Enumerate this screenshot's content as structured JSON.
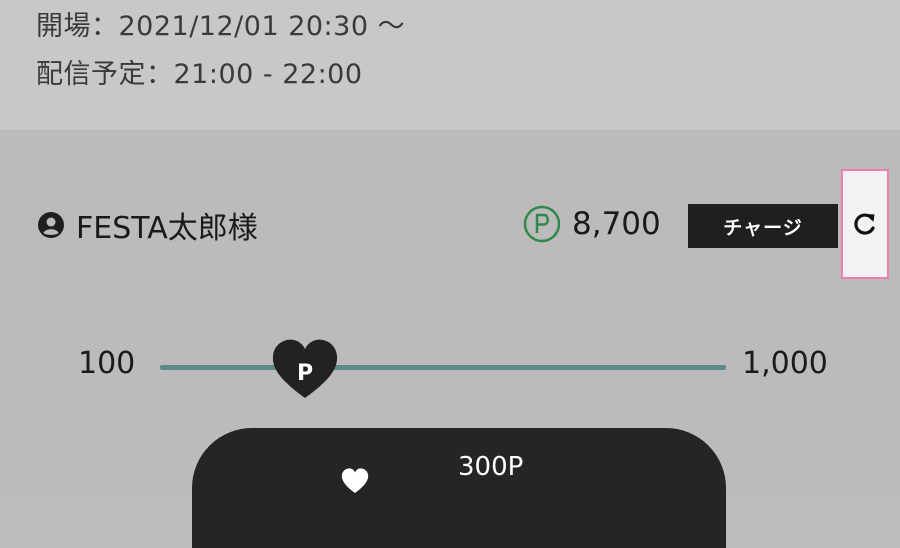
{
  "event": {
    "open_label": "開場",
    "open_value": "2021/12/01 20:30 ～",
    "stream_label": "配信予定",
    "stream_value": "21:00 - 22:00",
    "separator": "："
  },
  "user": {
    "icon": "user-circle-icon",
    "name": "FESTA太郎様"
  },
  "points": {
    "icon": "point-p-circle-icon",
    "value": "8,700",
    "charge_label": "チャージ",
    "refresh_icon": "refresh-icon",
    "accent_color": "#2f8a4a"
  },
  "slider": {
    "min_label": "100",
    "max_label": "1,000",
    "handle_label": "P",
    "value_fraction": 0.21,
    "track_color": "#5f8a8a"
  },
  "bet": {
    "icon": "heart-icon",
    "amount": "300P"
  }
}
